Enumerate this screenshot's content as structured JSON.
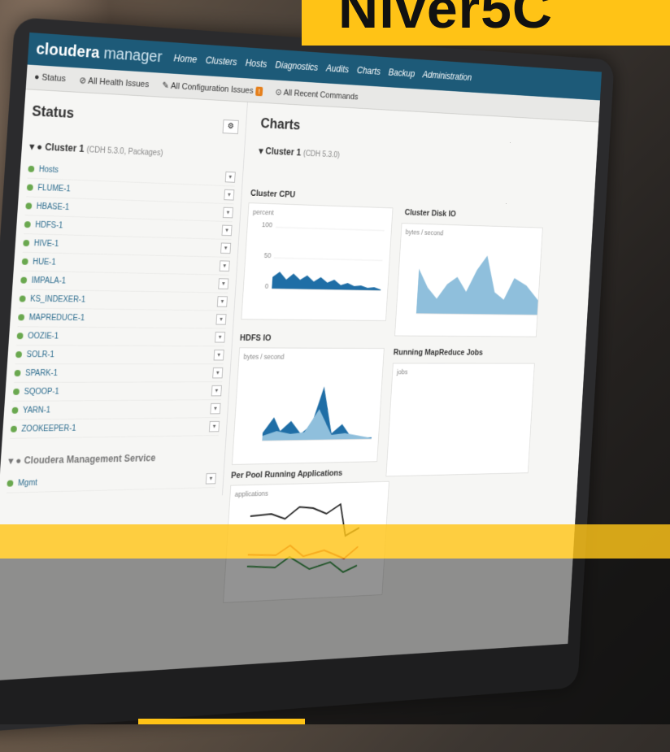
{
  "banner": {
    "title": "Niver5C"
  },
  "app": {
    "brand_main": "cloudera",
    "brand_sub": "manager",
    "nav": [
      "Home",
      "Clusters",
      "Hosts",
      "Diagnostics",
      "Audits",
      "Charts",
      "Backup",
      "Administration"
    ]
  },
  "subnav": {
    "status": "Status",
    "health": "All Health Issues",
    "config": "All Configuration Issues",
    "config_badge": "!",
    "commands": "All Recent Commands"
  },
  "status_panel": {
    "title": "Status",
    "cluster_name": "Cluster 1",
    "cluster_sub": "(CDH 5.3.0, Packages)",
    "services": [
      "Hosts",
      "FLUME-1",
      "HBASE-1",
      "HDFS-1",
      "HIVE-1",
      "HUE-1",
      "IMPALA-1",
      "KS_INDEXER-1",
      "MAPREDUCE-1",
      "OOZIE-1",
      "SOLR-1",
      "SPARK-1",
      "SQOOP-1",
      "YARN-1",
      "ZOOKEEPER-1"
    ],
    "mgmt": "Cloudera Management Service",
    "mgmt_item": "Mgmt"
  },
  "charts_panel": {
    "title": "Charts",
    "cluster": "Cluster 1",
    "cluster_sub": "(CDH 5.3.0)",
    "cpu_title": "Cluster CPU",
    "cpu_unit": "percent",
    "cpu_ticks": [
      "100",
      "50",
      "0"
    ],
    "disk_title": "Cluster Disk IO",
    "disk_unit": "bytes / second",
    "hdfs_title": "HDFS IO",
    "hdfs_unit": "bytes / second",
    "mr_title": "Running MapReduce Jobs",
    "mr_unit": "jobs",
    "pool_title": "Per Pool Running Applications",
    "pool_unit": "applications"
  },
  "colors": {
    "accent": "#ffc316",
    "nav": "#1d5a78",
    "chart_dark": "#1f6ea6",
    "chart_light": "#8fbfdc"
  }
}
